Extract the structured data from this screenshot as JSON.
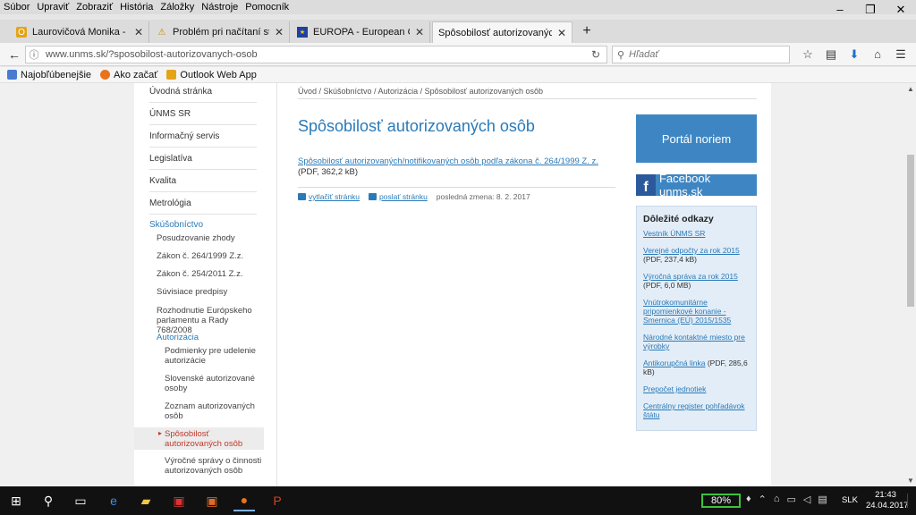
{
  "menubar": [
    "Súbor",
    "Upraviť",
    "Zobraziť",
    "História",
    "Záložky",
    "Nástroje",
    "Pomocník"
  ],
  "window_controls": {
    "minimize": "–",
    "restore": "❐",
    "close": "✕"
  },
  "tabs": [
    {
      "label": "Laurovičová Monika - Outlo",
      "icon": "outlook-icon",
      "active": false
    },
    {
      "label": "Problém pri načítaní stránky",
      "icon": "warning-icon",
      "active": false
    },
    {
      "label": "EUROPA - European Comm",
      "icon": "eu-flag-icon",
      "active": false
    },
    {
      "label": "Spôsobilosť autorizovaných osôb",
      "icon": "",
      "active": true
    }
  ],
  "new_tab": "+",
  "navbar": {
    "url": "www.unms.sk/?sposobilost-autorizovanych-osob",
    "search_placeholder": "Hľadať"
  },
  "bookmarks": [
    {
      "label": "Najobľúbenejšie",
      "color": "#4a7bd1"
    },
    {
      "label": "Ako začať",
      "color": "#e8731c"
    },
    {
      "label": "Outlook Web App",
      "color": "#e3a418"
    }
  ],
  "sidebar": {
    "top": [
      "Úvodná stránka",
      "ÚNMS SR",
      "Informačný servis",
      "Legislatíva",
      "Kvalita",
      "Metrológia"
    ],
    "section": "Skúšobníctvo",
    "sub": [
      "Posudzovanie zhody",
      "Zákon č. 264/1999 Z.z.",
      "Zákon č. 254/2011 Z.z.",
      "Súvisiace predpisy",
      "Rozhodnutie Európskeho parlamentu a Rady 768/2008"
    ],
    "sub_section": "Autorizácia",
    "sub2": [
      "Podmienky pre udelenie autorizácie",
      "Slovenské autorizované osoby",
      "Zoznam autorizovaných osôb"
    ],
    "active": "Spôsobilosť autorizovaných osôb",
    "after": "Výročné správy o činnosti autorizovaných osôb"
  },
  "breadcrumb": "Úvod / Skúšobníctvo / Autorizácia / Spôsobilosť autorizovaných osôb",
  "page_title": "Spôsobilosť autorizovaných osôb",
  "document": {
    "link": "Spôsobilosť autorizovaných/notifikovaných osôb podľa zákona č. 264/1999 Z. z.",
    "meta": "(PDF, 362,2 kB)"
  },
  "actions": {
    "print": "vytlačiť stránku",
    "send": "poslať stránku",
    "last_change": "posledná zmena: 8. 2. 2017"
  },
  "right": {
    "portal": "Portál noriem",
    "facebook": "Facebook unms.sk",
    "links_heading": "Dôležité odkazy",
    "links": [
      {
        "text": "Vestník ÚNMS SR",
        "meta": ""
      },
      {
        "text": "Verejné odpočty za rok 2015",
        "meta": "(PDF, 237,4 kB)"
      },
      {
        "text": "Výročná správa za rok 2015",
        "meta": "(PDF, 6,0 MB)"
      },
      {
        "text": "Vnútrokomunitárne pripomienkové konanie - Smernica (EÚ) 2015/1535",
        "meta": ""
      },
      {
        "text": "Národné kontaktné miesto pre výrobky",
        "meta": ""
      },
      {
        "text": "Antikorupčná linka",
        "meta": "(PDF, 285,6 kB)"
      },
      {
        "text": "Prepočet jednotiek",
        "meta": ""
      },
      {
        "text": "Centrálny register pohľadávok štátu",
        "meta": ""
      }
    ]
  },
  "taskbar": {
    "zoom": "80%",
    "lang": "SLK",
    "time": "21:43",
    "date": "24.04.2017"
  }
}
